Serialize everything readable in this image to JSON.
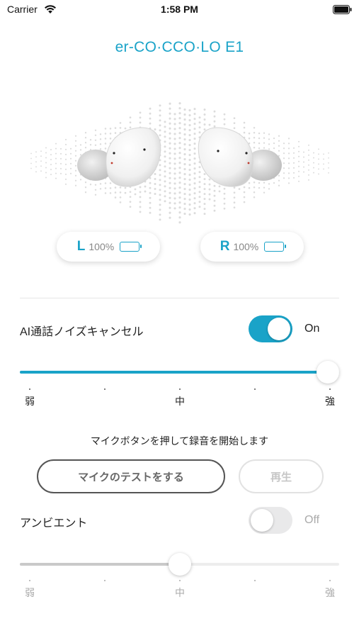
{
  "status_bar": {
    "carrier": "Carrier",
    "time": "1:58 PM"
  },
  "device": {
    "title": "er-CO·CCO·LO E1"
  },
  "battery": {
    "left": {
      "side": "L",
      "percent": "100%",
      "level": 1.0
    },
    "right": {
      "side": "R",
      "percent": "100%",
      "level": 1.0
    }
  },
  "noise_cancel": {
    "label": "AI通話ノイズキャンセル",
    "state": "On",
    "enabled": true,
    "level": 1.0,
    "scale": {
      "weak": "弱",
      "mid": "中",
      "strong": "強"
    }
  },
  "mic_test": {
    "instruction": "マイクボタンを押して録音を開始します",
    "test_button": "マイクのテストをする",
    "play_button": "再生"
  },
  "ambient": {
    "label": "アンビエント",
    "state": "Off",
    "enabled": false,
    "level": 0.5,
    "scale": {
      "weak": "弱",
      "mid": "中",
      "strong": "強"
    }
  },
  "colors": {
    "accent": "#1aa3c8",
    "inactive_track": "#c9c9c9",
    "toggle_off": "#e9e9ea"
  },
  "icons": {
    "wifi": "wifi-icon",
    "battery": "battery-icon"
  }
}
